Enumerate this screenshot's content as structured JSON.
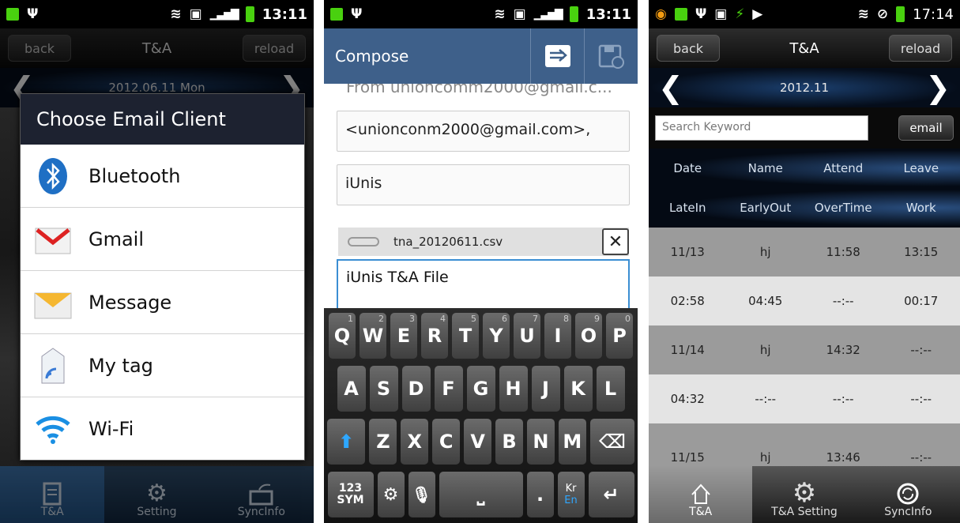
{
  "panel1": {
    "status": {
      "time": "13:11",
      "battery_label": "100%"
    },
    "header": {
      "back": "back",
      "title": "T&A",
      "reload": "reload"
    },
    "date": "2012.06.11 Mon",
    "dialog": {
      "title": "Choose Email Client",
      "items": [
        {
          "label": "Bluetooth",
          "icon": "bluetooth-icon"
        },
        {
          "label": "Gmail",
          "icon": "gmail-icon"
        },
        {
          "label": "Message",
          "icon": "message-icon"
        },
        {
          "label": "My tag",
          "icon": "my-tag-icon"
        },
        {
          "label": "Wi-Fi",
          "icon": "wifi-icon"
        }
      ]
    },
    "nav": [
      "T&A",
      "Setting",
      "SyncInfo"
    ]
  },
  "panel2": {
    "status": {
      "time": "13:11",
      "battery_label": "100%"
    },
    "header": {
      "title": "Compose"
    },
    "from": "From unioncomm2000@gmail.c...",
    "to": "<unionconm2000@gmail.com>,",
    "subject": "iUnis",
    "attachment": "tna_20120611.csv",
    "body": "iUnis T&A File",
    "keyboard": {
      "row1": [
        [
          "Q",
          "1"
        ],
        [
          "W",
          "2"
        ],
        [
          "E",
          "3"
        ],
        [
          "R",
          "4"
        ],
        [
          "T",
          "5"
        ],
        [
          "Y",
          "6"
        ],
        [
          "U",
          "7"
        ],
        [
          "I",
          "8"
        ],
        [
          "O",
          "9"
        ],
        [
          "P",
          "0"
        ]
      ],
      "row2": [
        "A",
        "S",
        "D",
        "F",
        "G",
        "H",
        "J",
        "K",
        "L"
      ],
      "row3": [
        "Z",
        "X",
        "C",
        "V",
        "B",
        "N",
        "M"
      ],
      "sym": "123\nSYM",
      "period": ".",
      "lang_top": "Kr",
      "lang_bottom": "En"
    }
  },
  "panel3": {
    "status": {
      "time": "17:14",
      "battery_label": "100%"
    },
    "header": {
      "back": "back",
      "title": "T&A",
      "reload": "reload"
    },
    "date": "2012.11",
    "search_placeholder": "Search Keyword",
    "email_button": "email",
    "headers1": [
      "Date",
      "Name",
      "Attend",
      "Leave"
    ],
    "headers2": [
      "LateIn",
      "EarlyOut",
      "OverTime",
      "Work"
    ],
    "rows": [
      [
        "11/13",
        "hj",
        "11:58",
        "13:15"
      ],
      [
        "02:58",
        "04:45",
        "--:--",
        "00:17"
      ],
      [
        "11/14",
        "hj",
        "14:32",
        "--:--"
      ],
      [
        "04:32",
        "--:--",
        "--:--",
        "--:--"
      ],
      [
        "11/15",
        "hj",
        "13:46",
        "--:--"
      ]
    ],
    "nav": [
      "T&A",
      "T&A Setting",
      "SyncInfo"
    ]
  }
}
